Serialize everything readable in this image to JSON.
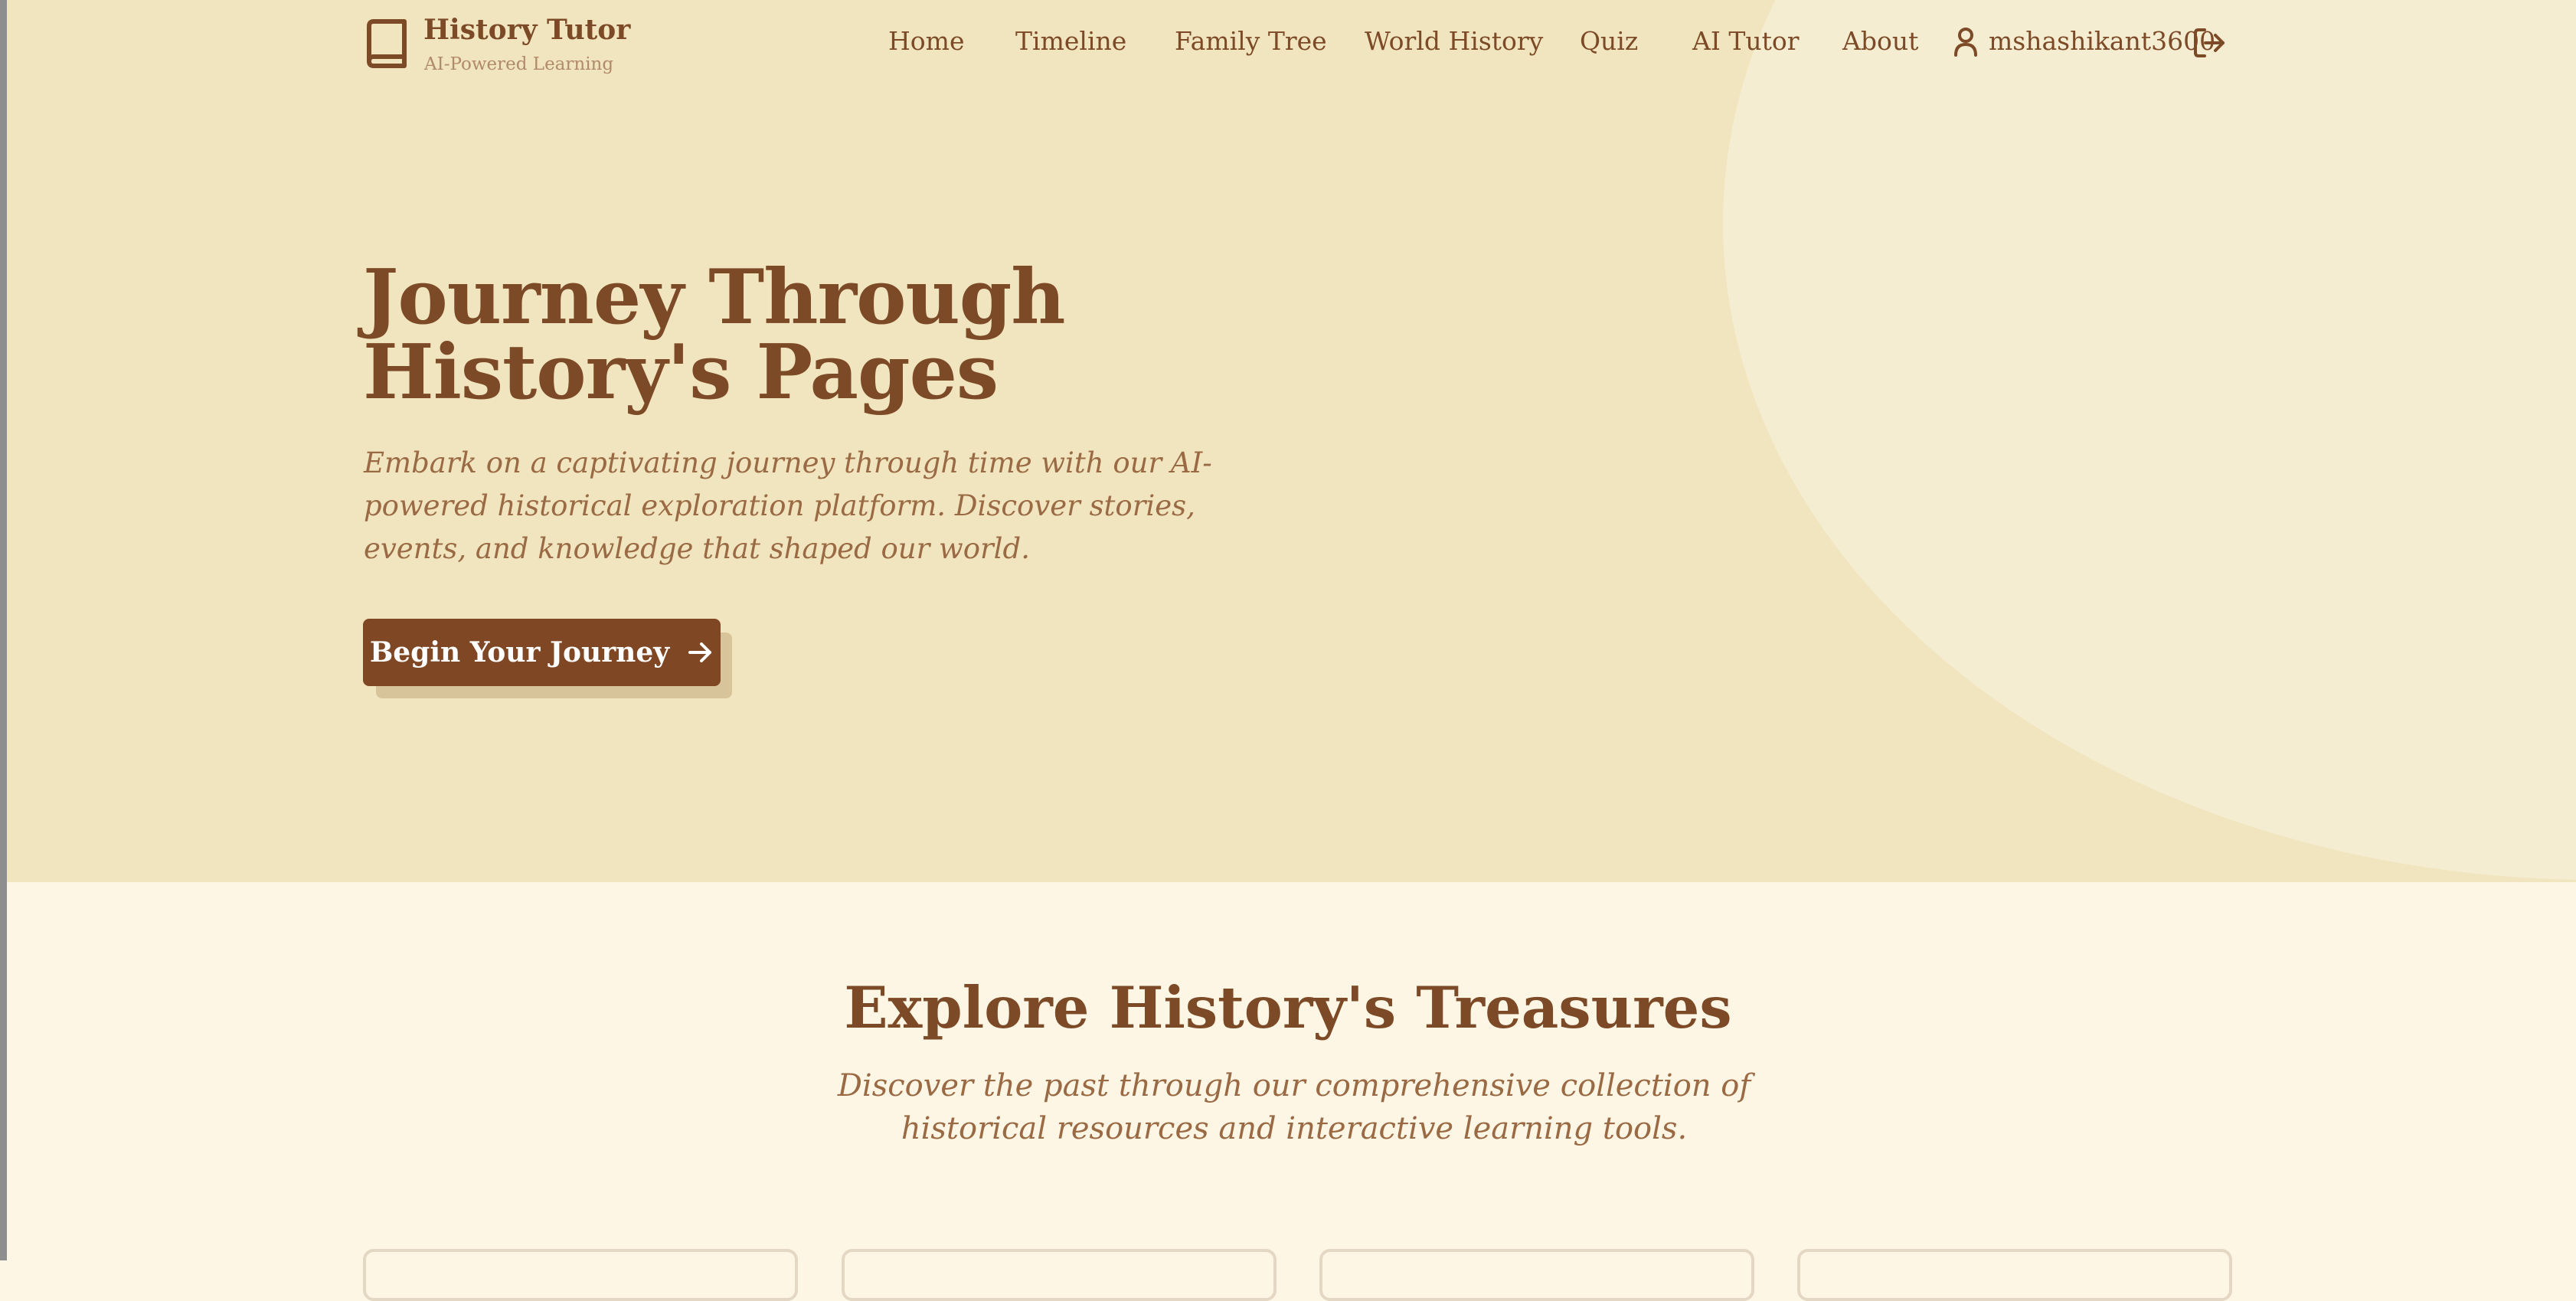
{
  "brand": {
    "title": "History Tutor",
    "subtitle": "AI-Powered Learning"
  },
  "nav": {
    "links": [
      {
        "label": "Home"
      },
      {
        "label": "Timeline"
      },
      {
        "label": "Family Tree"
      },
      {
        "label": "World History"
      },
      {
        "label": "Quiz"
      },
      {
        "label": "AI Tutor"
      },
      {
        "label": "About"
      }
    ],
    "username": "mshashikant3600"
  },
  "hero": {
    "title_line1": "Journey Through",
    "title_line2": "History's Pages",
    "description": "Embark on a captivating journey through time with our AI-powered historical exploration platform. Discover stories, events, and knowledge that shaped our world.",
    "cta_label": "Begin Your Journey"
  },
  "explore": {
    "title": "Explore History's Treasures",
    "description": "Discover the past through our comprehensive collection of historical resources and interactive learning tools."
  },
  "colors": {
    "primary_brown": "#7f4723",
    "hero_bg": "#f1e5bf",
    "hero_circle": "#f5edd1",
    "page_bg": "#fdf6e4",
    "muted_text": "#9a6a44"
  },
  "icons": [
    "book-icon",
    "user-icon",
    "logout-icon",
    "arrow-right-icon"
  ]
}
